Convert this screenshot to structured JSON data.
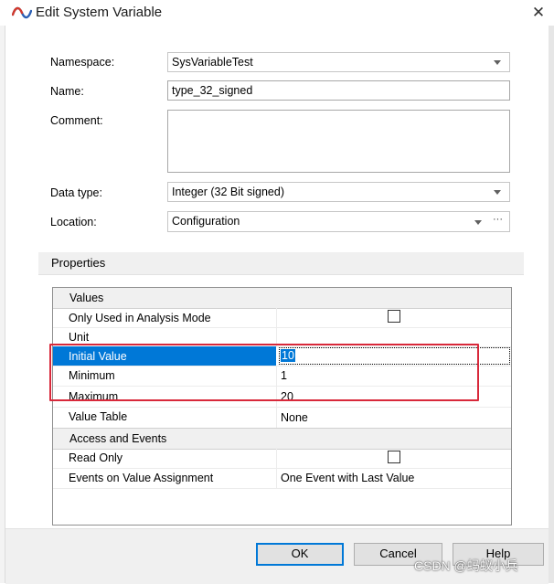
{
  "window": {
    "title": "Edit System Variable",
    "close_glyph": "✕"
  },
  "form": {
    "namespace_label": "Namespace:",
    "namespace_value": "SysVariableTest",
    "name_label": "Name:",
    "name_value": "type_32_signed",
    "comment_label": "Comment:",
    "comment_value": "",
    "datatype_label": "Data type:",
    "datatype_value": "Integer (32 Bit signed)",
    "location_label": "Location:",
    "location_value": "Configuration",
    "location_more": "···"
  },
  "properties": {
    "header": "Properties",
    "categories": [
      {
        "name": "Values",
        "rows": [
          {
            "key": "Only Used in Analysis Mode",
            "value": "",
            "checkbox": true,
            "checked": false
          },
          {
            "key": "Unit",
            "value": ""
          },
          {
            "key": "Initial Value",
            "value": "10",
            "selected": true
          },
          {
            "key": "Minimum",
            "value": "1"
          },
          {
            "key": "Maximum",
            "value": "20"
          },
          {
            "key": "Value Table",
            "value": "None"
          }
        ]
      },
      {
        "name": "Access and Events",
        "rows": [
          {
            "key": "Read Only",
            "value": "",
            "checkbox": true,
            "checked": false
          },
          {
            "key": "Events on Value Assignment",
            "value": "One Event with Last Value"
          }
        ]
      }
    ]
  },
  "buttons": {
    "ok": "OK",
    "cancel": "Cancel",
    "help": "Help"
  },
  "watermark": "CSDN @蚂蚁小兵",
  "colors": {
    "selection": "#0078d7",
    "highlight_box": "#d8283a"
  }
}
